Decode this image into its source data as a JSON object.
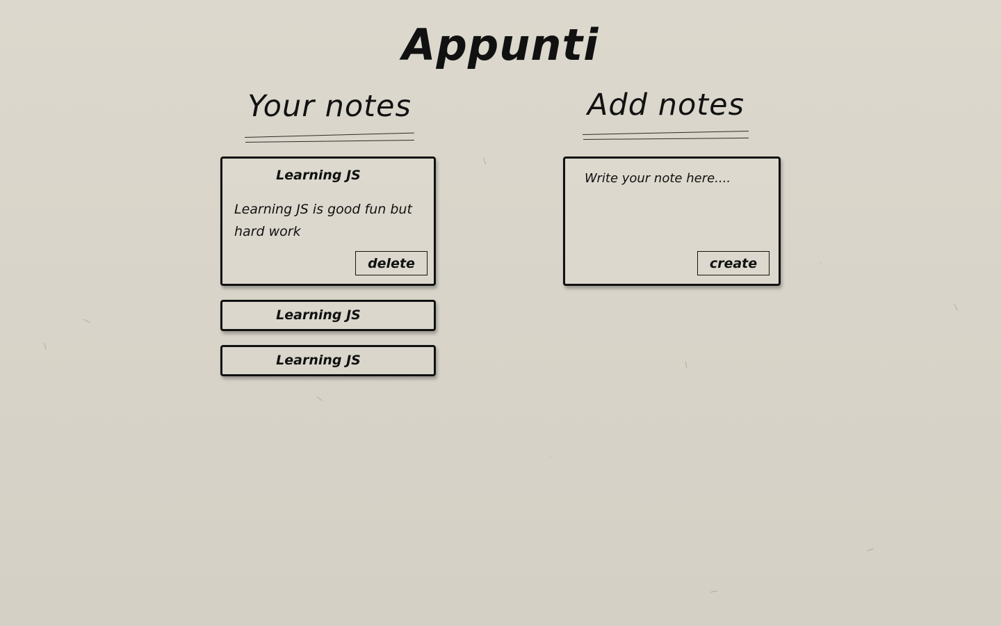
{
  "app": {
    "title": "Appunti"
  },
  "notes_section": {
    "heading": "Your notes",
    "notes": [
      {
        "title": "Learning JS",
        "body": "Learning JS is good fun but hard work",
        "delete_label": "delete"
      },
      {
        "title": "Learning JS"
      },
      {
        "title": "Learning JS"
      }
    ]
  },
  "add_section": {
    "heading": "Add notes",
    "input_value": "",
    "input_placeholder": "Write your note here....",
    "create_label": "create"
  },
  "theme": {
    "background": "#d9d5ca",
    "ink": "#111111"
  }
}
